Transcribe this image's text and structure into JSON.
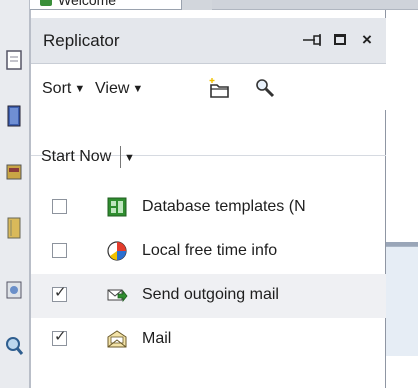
{
  "top_tab": {
    "label": "Welcome"
  },
  "panel": {
    "title": "Replicator",
    "title_buttons": {
      "pin": "⇥□",
      "close": "×"
    }
  },
  "toolbar": {
    "sort_label": "Sort",
    "view_label": "View",
    "caret": "▼"
  },
  "actions": {
    "start_now_label": "Start Now",
    "caret": "▼"
  },
  "replication_items": [
    {
      "label": "Database templates (N",
      "checked": false,
      "icon": "database-templates-icon"
    },
    {
      "label": "Local free time info",
      "checked": false,
      "icon": "free-time-icon"
    },
    {
      "label": "Send outgoing mail",
      "checked": true,
      "icon": "outgoing-mail-icon"
    },
    {
      "label": "Mail",
      "checked": true,
      "icon": "mail-icon"
    }
  ],
  "check_glyph": "✓",
  "colors": {
    "title_bar_bg": "#e4e7ec",
    "launcher_bg": "#e9ebef",
    "selected_row_bg": "#eff0f3",
    "accent_green": "#2f8d2f"
  }
}
